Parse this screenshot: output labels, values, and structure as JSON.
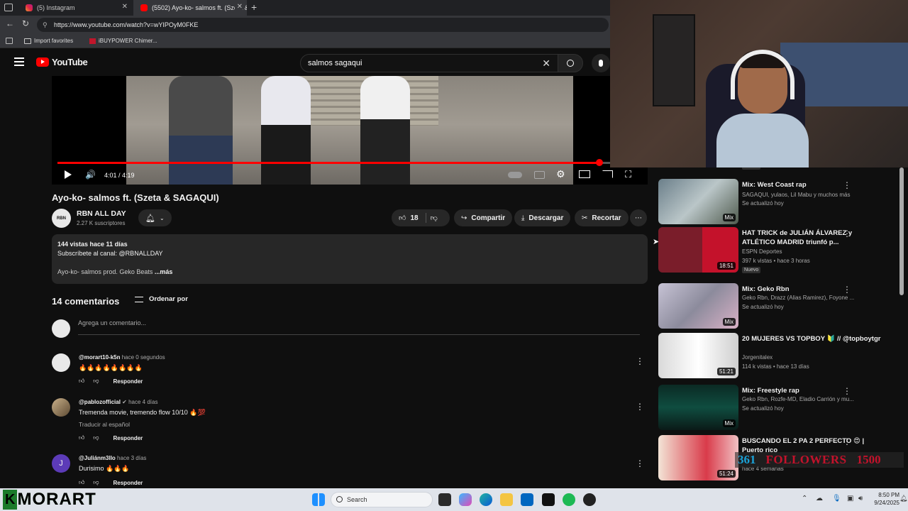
{
  "browser": {
    "tabs": [
      {
        "label": "(5) Instagram",
        "color": "#d6249f"
      },
      {
        "label": "(5502) Ayo-ko- salmos ft. (Szeta &",
        "color": "#ff0000"
      }
    ],
    "url": "https://www.youtube.com/watch?v=wYIPOyM0FKE",
    "bookmarks": [
      "Import favorites",
      "iBUYPOWER Chimer..."
    ]
  },
  "youtube": {
    "logo": "YouTube",
    "search_query": "salmos sagaqui",
    "player": {
      "time": "4:01 / 4:19",
      "progress": 0.927
    },
    "video_title": "Ayo-ko- salmos ft. (Szeta & SAGAQUI)",
    "channel": {
      "name": "RBN ALL DAY",
      "subs": "2.27 K suscriptores",
      "avatar": "RBN"
    },
    "actions": {
      "likes": "18",
      "share": "Compartir",
      "download": "Descargar",
      "clip": "Recortar"
    },
    "description": {
      "stats": "144 vistas  hace 11 días",
      "line1": "Subscríbete al canal: @RBNALLDAY",
      "line2": "Ayo-ko- salmos prod. Geko Beats",
      "more": "...más"
    },
    "comments": {
      "count": "14 comentarios",
      "sort": "Ordenar por",
      "add_placeholder": "Agrega un comentario...",
      "reply": "Responder",
      "items": [
        {
          "author": "@morart10-k5n",
          "time": "hace 0 segundos",
          "text": "🔥🔥🔥🔥🔥🔥🔥🔥",
          "translate": ""
        },
        {
          "author": "@pablozofficial",
          "time": "hace 4 días",
          "text": "Tremenda movie, tremendo flow 10/10 🔥💯",
          "translate": "Traducir al español"
        },
        {
          "author": "@Juliánm3llo",
          "time": "hace 3 días",
          "text": "Durisimo 🔥🔥🔥",
          "translate": "",
          "initial": "J"
        }
      ]
    },
    "recommendations": [
      {
        "title": "Mix: West Coast rap",
        "meta1": "SAGAQUI, yulaos, Lil Mabu y muchos más",
        "meta2": "Se actualizó hoy",
        "duration": "Mix",
        "badge": ""
      },
      {
        "title": "HAT TRICK de JULIÁN ÁLVAREZ y ATLÉTICO MADRID triunfó p...",
        "meta1": "ESPN Deportes",
        "meta2": "397 k vistas • hace 3 horas",
        "duration": "18:51",
        "badge": "Nuevo"
      },
      {
        "title": "Mix: Geko Rbn",
        "meta1": "Geko Rbn, Drazz (Alias Ramirez), Foyone ...",
        "meta2": "Se actualizó hoy",
        "duration": "Mix",
        "badge": ""
      },
      {
        "title": "20 MUJERES VS TOPBOY 🔰 // @topboytgr",
        "meta1": "Jorgenitalex",
        "meta2": "114 k vistas • hace 13 días",
        "duration": "51:21",
        "badge": ""
      },
      {
        "title": "Mix: Freestyle rap",
        "meta1": "Geko Rbn, Rozfe-MD, Eladio Carrión y mu...",
        "meta2": "Se actualizó hoy",
        "duration": "Mix",
        "badge": ""
      },
      {
        "title": "BUSCANDO EL 2 PA 2 PERFECTO 😍 | Puerto rico",
        "meta1": "",
        "meta2": "hace 4 semanas",
        "duration": "51:24",
        "badge": ""
      }
    ],
    "top_badge": "Nuevo"
  },
  "overlay": {
    "followers_current": "361",
    "followers_label": "FOLLOWERS",
    "followers_goal": "1500",
    "brand": "MORART",
    "brand_initial": "K"
  },
  "taskbar": {
    "search": "Search",
    "time": "8:50 PM",
    "date": "9/24/2025"
  }
}
